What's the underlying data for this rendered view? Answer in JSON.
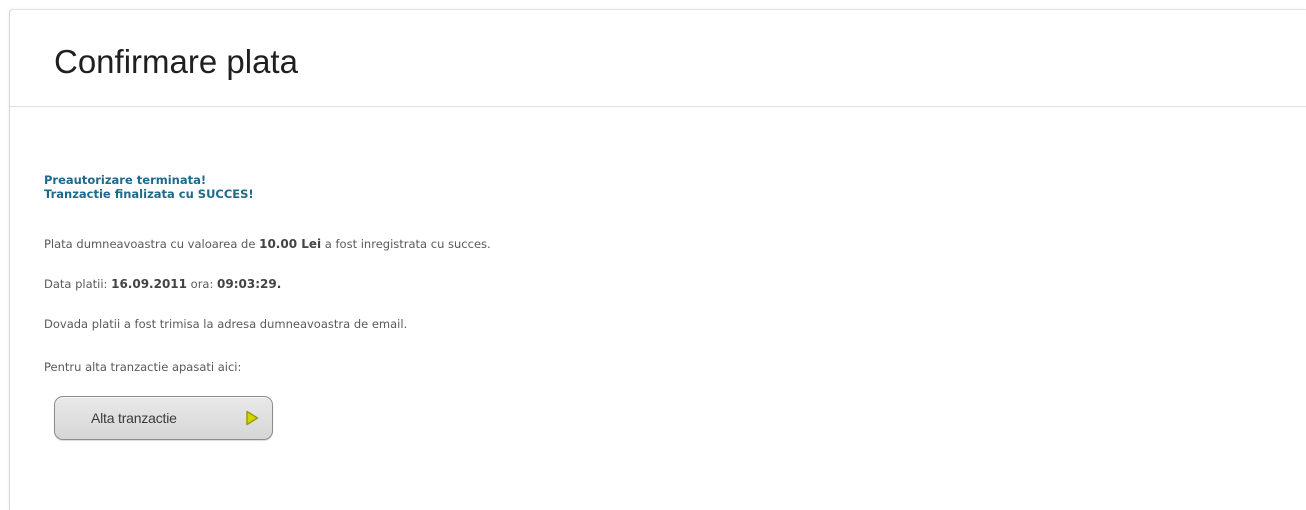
{
  "header": {
    "title": "Confirmare plata"
  },
  "status": {
    "line1": "Preautorizare terminata!",
    "line2": "Tranzactie finalizata cu SUCCES!"
  },
  "payment": {
    "amount_prefix": "Plata dumneavoastra cu valoarea de ",
    "amount": "10.00 Lei",
    "amount_suffix": " a fost inregistrata cu succes.",
    "date_prefix": "Data platii: ",
    "date": "16.09.2011",
    "time_prefix": " ora: ",
    "time": "09:03:29.",
    "email_notice": "Dovada platii a fost trimisa la adresa dumneavoastra de email.",
    "new_transaction_prompt": "Pentru alta tranzactie apasati aici:"
  },
  "button": {
    "label": "Alta tranzactie",
    "icon": "play-triangle-icon",
    "icon_color": "#d4d400",
    "icon_stroke": "#9a9a00"
  },
  "colors": {
    "status_text": "#1e6a8a",
    "body_text": "#5a5a5a",
    "title_text": "#1f1f1f"
  }
}
